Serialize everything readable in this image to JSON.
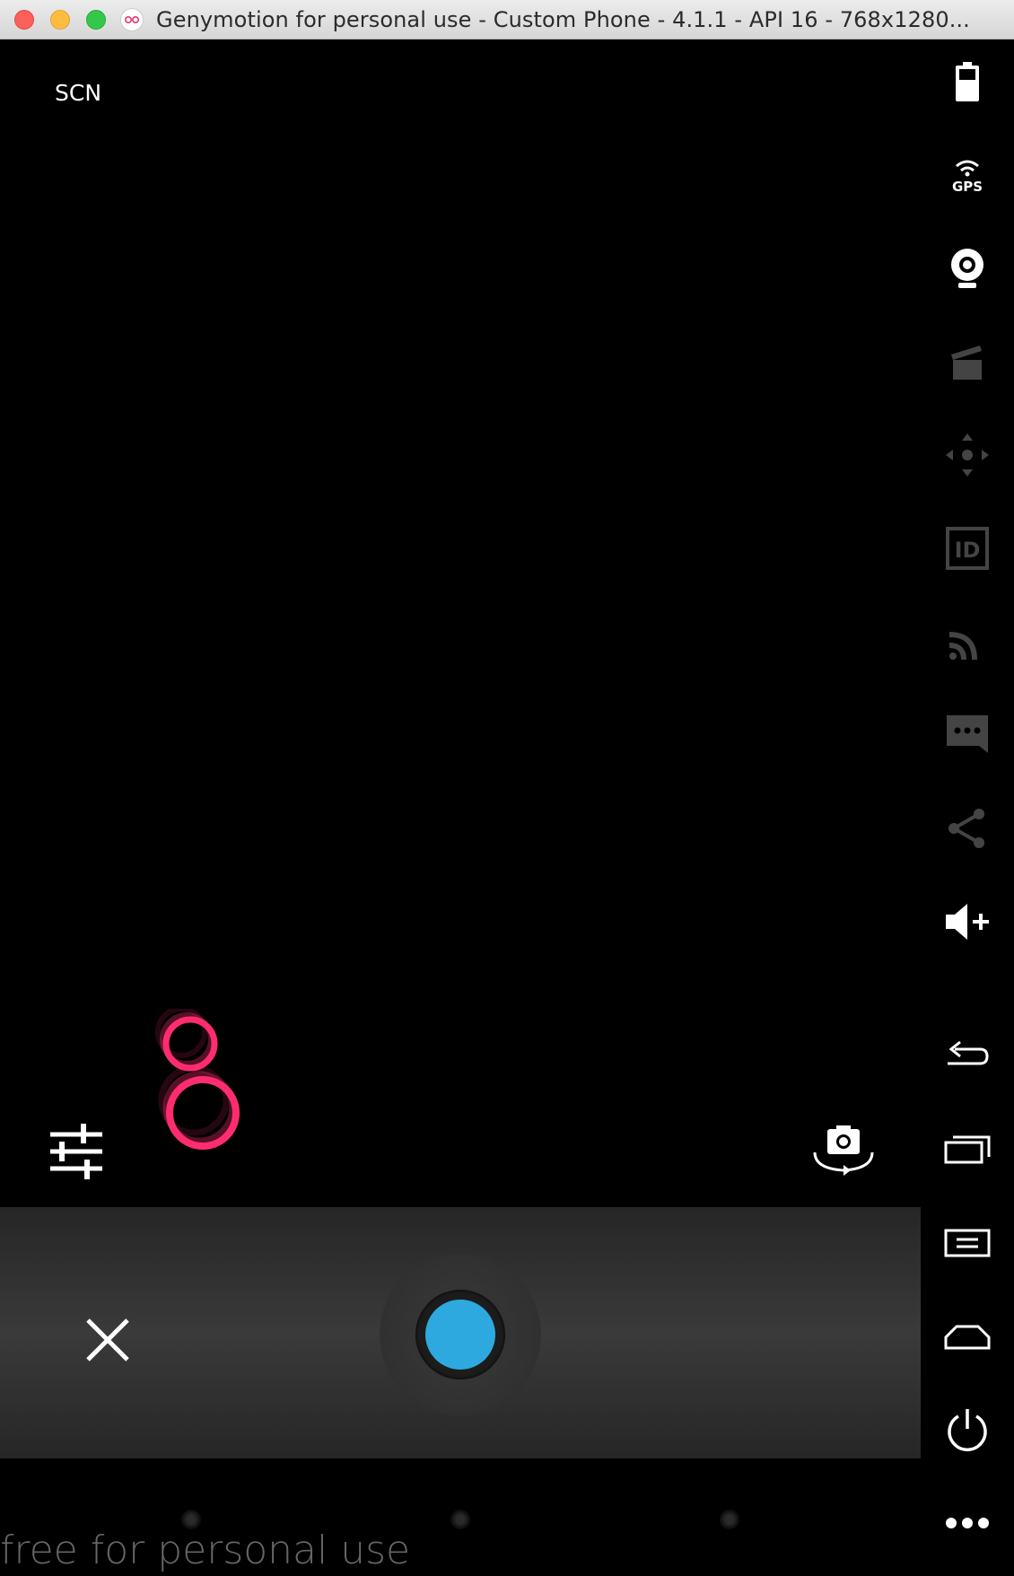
{
  "window": {
    "title": "Genymotion for personal use - Custom Phone - 4.1.1 - API 16 - 768x1280..."
  },
  "camera": {
    "scene_mode_label": "SCN",
    "shutter_color": "#2ea9df",
    "touch_ring_color": "#ff2d6f"
  },
  "watermark": {
    "text": "free for personal use"
  },
  "toolbar": {
    "items": [
      {
        "name": "battery",
        "icon": "battery-icon"
      },
      {
        "name": "gps",
        "icon": "gps-icon",
        "label": "GPS"
      },
      {
        "name": "webcam",
        "icon": "webcam-icon"
      },
      {
        "name": "screencast",
        "icon": "clapperboard-icon"
      },
      {
        "name": "remote-control",
        "icon": "move-icon"
      },
      {
        "name": "identifiers",
        "icon": "id-icon",
        "label": "ID"
      },
      {
        "name": "network",
        "icon": "signal-icon"
      },
      {
        "name": "phone-sms",
        "icon": "message-icon"
      },
      {
        "name": "share",
        "icon": "share-icon"
      },
      {
        "name": "volume-up",
        "icon": "volume-up-icon"
      },
      {
        "name": "back",
        "icon": "back-icon"
      },
      {
        "name": "recent-apps",
        "icon": "recent-apps-icon"
      },
      {
        "name": "menu",
        "icon": "menu-icon"
      },
      {
        "name": "home",
        "icon": "home-icon"
      },
      {
        "name": "power",
        "icon": "power-icon"
      },
      {
        "name": "more",
        "icon": "more-icon"
      }
    ]
  }
}
